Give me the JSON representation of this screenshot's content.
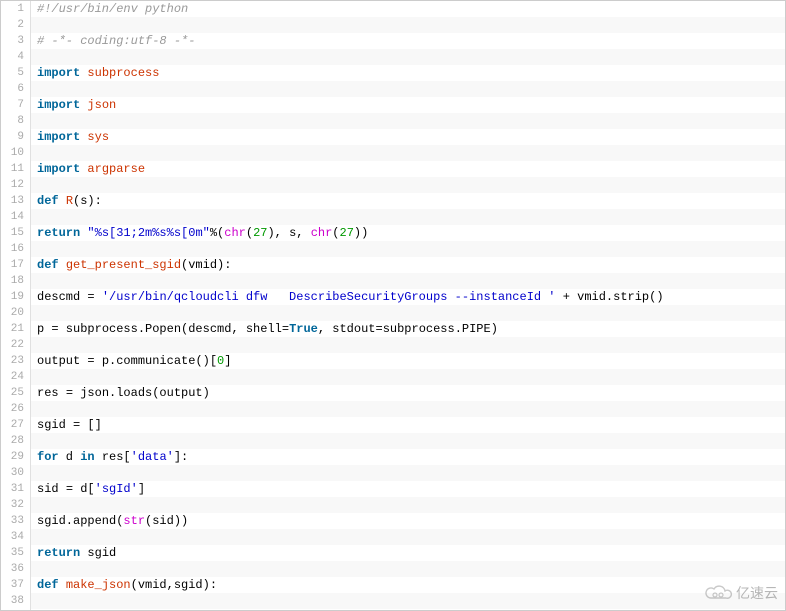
{
  "watermark": {
    "text": "亿速云"
  },
  "lines": [
    {
      "n": 1,
      "tokens": [
        {
          "cls": "c-comment",
          "t": "#!/usr/bin/env python"
        }
      ]
    },
    {
      "n": 2,
      "tokens": []
    },
    {
      "n": 3,
      "tokens": [
        {
          "cls": "c-comment",
          "t": "# -*- coding:utf-8 -*-"
        }
      ]
    },
    {
      "n": 4,
      "tokens": []
    },
    {
      "n": 5,
      "tokens": [
        {
          "cls": "c-keyword",
          "t": "import"
        },
        {
          "cls": "c-ident",
          "t": " "
        },
        {
          "cls": "c-module",
          "t": "subprocess"
        }
      ]
    },
    {
      "n": 6,
      "tokens": []
    },
    {
      "n": 7,
      "tokens": [
        {
          "cls": "c-keyword",
          "t": "import"
        },
        {
          "cls": "c-ident",
          "t": " "
        },
        {
          "cls": "c-module",
          "t": "json"
        }
      ]
    },
    {
      "n": 8,
      "tokens": []
    },
    {
      "n": 9,
      "tokens": [
        {
          "cls": "c-keyword",
          "t": "import"
        },
        {
          "cls": "c-ident",
          "t": " "
        },
        {
          "cls": "c-module",
          "t": "sys"
        }
      ]
    },
    {
      "n": 10,
      "tokens": []
    },
    {
      "n": 11,
      "tokens": [
        {
          "cls": "c-keyword",
          "t": "import"
        },
        {
          "cls": "c-ident",
          "t": " "
        },
        {
          "cls": "c-module",
          "t": "argparse"
        }
      ]
    },
    {
      "n": 12,
      "tokens": []
    },
    {
      "n": 13,
      "tokens": [
        {
          "cls": "c-keyword",
          "t": "def"
        },
        {
          "cls": "c-ident",
          "t": " "
        },
        {
          "cls": "c-func",
          "t": "R"
        },
        {
          "cls": "c-ident",
          "t": "(s):"
        }
      ]
    },
    {
      "n": 14,
      "tokens": []
    },
    {
      "n": 15,
      "tokens": [
        {
          "cls": "c-keyword",
          "t": "return"
        },
        {
          "cls": "c-ident",
          "t": " "
        },
        {
          "cls": "c-string",
          "t": "\"%s[31;2m%s%s[0m\""
        },
        {
          "cls": "c-ident",
          "t": "%("
        },
        {
          "cls": "c-builtin",
          "t": "chr"
        },
        {
          "cls": "c-ident",
          "t": "("
        },
        {
          "cls": "c-number",
          "t": "27"
        },
        {
          "cls": "c-ident",
          "t": "), s, "
        },
        {
          "cls": "c-builtin",
          "t": "chr"
        },
        {
          "cls": "c-ident",
          "t": "("
        },
        {
          "cls": "c-number",
          "t": "27"
        },
        {
          "cls": "c-ident",
          "t": "))"
        }
      ]
    },
    {
      "n": 16,
      "tokens": []
    },
    {
      "n": 17,
      "tokens": [
        {
          "cls": "c-keyword",
          "t": "def"
        },
        {
          "cls": "c-ident",
          "t": " "
        },
        {
          "cls": "c-func",
          "t": "get_present_sgid"
        },
        {
          "cls": "c-ident",
          "t": "(vmid):"
        }
      ]
    },
    {
      "n": 18,
      "tokens": []
    },
    {
      "n": 19,
      "tokens": [
        {
          "cls": "c-ident",
          "t": "descmd "
        },
        {
          "cls": "c-op",
          "t": "="
        },
        {
          "cls": "c-ident",
          "t": " "
        },
        {
          "cls": "c-string",
          "t": "'/usr/bin/qcloudcli dfw   DescribeSecurityGroups --instanceId '"
        },
        {
          "cls": "c-ident",
          "t": " "
        },
        {
          "cls": "c-op",
          "t": "+"
        },
        {
          "cls": "c-ident",
          "t": " vmid.strip()"
        }
      ]
    },
    {
      "n": 20,
      "tokens": []
    },
    {
      "n": 21,
      "tokens": [
        {
          "cls": "c-ident",
          "t": "p "
        },
        {
          "cls": "c-op",
          "t": "="
        },
        {
          "cls": "c-ident",
          "t": " subprocess.Popen(descmd, shell"
        },
        {
          "cls": "c-op",
          "t": "="
        },
        {
          "cls": "c-const",
          "t": "True"
        },
        {
          "cls": "c-ident",
          "t": ", stdout"
        },
        {
          "cls": "c-op",
          "t": "="
        },
        {
          "cls": "c-ident",
          "t": "subprocess.PIPE)"
        }
      ]
    },
    {
      "n": 22,
      "tokens": []
    },
    {
      "n": 23,
      "tokens": [
        {
          "cls": "c-ident",
          "t": "output "
        },
        {
          "cls": "c-op",
          "t": "="
        },
        {
          "cls": "c-ident",
          "t": " p.communicate()["
        },
        {
          "cls": "c-number",
          "t": "0"
        },
        {
          "cls": "c-ident",
          "t": "]"
        }
      ]
    },
    {
      "n": 24,
      "tokens": []
    },
    {
      "n": 25,
      "tokens": [
        {
          "cls": "c-ident",
          "t": "res "
        },
        {
          "cls": "c-op",
          "t": "="
        },
        {
          "cls": "c-ident",
          "t": " json.loads(output)"
        }
      ]
    },
    {
      "n": 26,
      "tokens": []
    },
    {
      "n": 27,
      "tokens": [
        {
          "cls": "c-ident",
          "t": "sgid "
        },
        {
          "cls": "c-op",
          "t": "="
        },
        {
          "cls": "c-ident",
          "t": " []"
        }
      ]
    },
    {
      "n": 28,
      "tokens": []
    },
    {
      "n": 29,
      "tokens": [
        {
          "cls": "c-keyword",
          "t": "for"
        },
        {
          "cls": "c-ident",
          "t": " d "
        },
        {
          "cls": "c-keyword",
          "t": "in"
        },
        {
          "cls": "c-ident",
          "t": " res["
        },
        {
          "cls": "c-string",
          "t": "'data'"
        },
        {
          "cls": "c-ident",
          "t": "]:"
        }
      ]
    },
    {
      "n": 30,
      "tokens": []
    },
    {
      "n": 31,
      "tokens": [
        {
          "cls": "c-ident",
          "t": "sid "
        },
        {
          "cls": "c-op",
          "t": "="
        },
        {
          "cls": "c-ident",
          "t": " d["
        },
        {
          "cls": "c-string",
          "t": "'sgId'"
        },
        {
          "cls": "c-ident",
          "t": "]"
        }
      ]
    },
    {
      "n": 32,
      "tokens": []
    },
    {
      "n": 33,
      "tokens": [
        {
          "cls": "c-ident",
          "t": "sgid.append("
        },
        {
          "cls": "c-builtin",
          "t": "str"
        },
        {
          "cls": "c-ident",
          "t": "(sid))"
        }
      ]
    },
    {
      "n": 34,
      "tokens": []
    },
    {
      "n": 35,
      "tokens": [
        {
          "cls": "c-keyword",
          "t": "return"
        },
        {
          "cls": "c-ident",
          "t": " sgid"
        }
      ]
    },
    {
      "n": 36,
      "tokens": []
    },
    {
      "n": 37,
      "tokens": [
        {
          "cls": "c-keyword",
          "t": "def"
        },
        {
          "cls": "c-ident",
          "t": " "
        },
        {
          "cls": "c-func",
          "t": "make_json"
        },
        {
          "cls": "c-ident",
          "t": "(vmid,sgid):"
        }
      ]
    },
    {
      "n": 38,
      "tokens": []
    }
  ]
}
